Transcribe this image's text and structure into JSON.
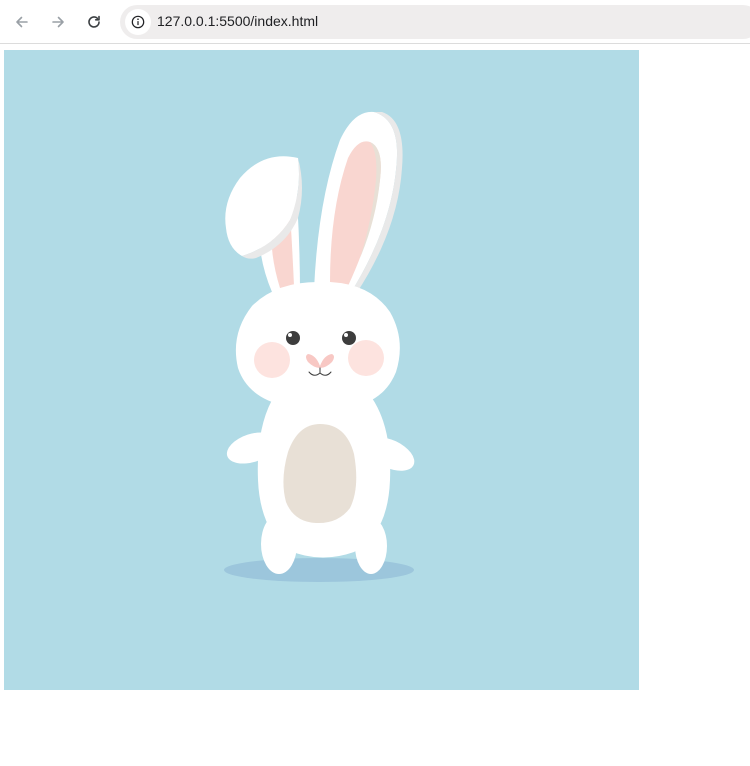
{
  "browser": {
    "url": "127.0.0.1:5500/index.html",
    "icons": {
      "back": "arrow-left-icon",
      "forward": "arrow-right-icon",
      "reload": "reload-icon",
      "site_info": "info-icon"
    }
  },
  "scene": {
    "subject": "bunny",
    "colors": {
      "background": "#b1dbe6",
      "body": "#ffffff",
      "ear_inner": "#f9d6d0",
      "belly": "#e8e0d6",
      "cheek": "#fde3df",
      "nose": "#f8c8c4",
      "eye": "#3d3d3d",
      "shadow": "#9cc6dc",
      "ear_shade": "#e9e9e9"
    }
  }
}
